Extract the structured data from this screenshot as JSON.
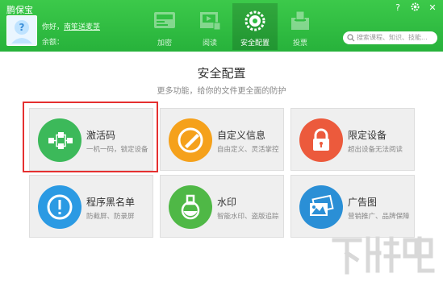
{
  "app": {
    "title": "鹏保宝"
  },
  "user": {
    "greeting_prefix": "你好，",
    "username": "南笙送麦茎",
    "balance_label": "余额："
  },
  "tabs": [
    {
      "label": "加密",
      "icon": "video-encrypt-icon"
    },
    {
      "label": "阅读",
      "icon": "film-reader-icon"
    },
    {
      "label": "安全配置",
      "icon": "gear-config-icon"
    },
    {
      "label": "投票",
      "icon": "vote-box-icon"
    }
  ],
  "window_buttons": {
    "help": "?",
    "settings": "gear-icon",
    "close": "✕"
  },
  "search": {
    "placeholder": "搜索课程、知识、技能..."
  },
  "main": {
    "title": "安全配置",
    "subtitle": "更多功能，给你的文件更全面的防护"
  },
  "cards": [
    {
      "title": "激活码",
      "subtitle": "一机一码，锁定设备",
      "icon": "flowchart-icon",
      "color": "#3cb95a"
    },
    {
      "title": "自定义信息",
      "subtitle": "自由定义、灵活掌控",
      "icon": "pencil-icon",
      "color": "#f5a11b"
    },
    {
      "title": "限定设备",
      "subtitle": "超出设备无法阅读",
      "icon": "lock-icon",
      "color": "#ec5a3c"
    },
    {
      "title": "程序黑名单",
      "subtitle": "防截屏、防录屏",
      "icon": "exclamation-icon",
      "color": "#2b9ae3"
    },
    {
      "title": "水印",
      "subtitle": "智能水印、盗版追踪",
      "icon": "flask-icon",
      "color": "#4fb846"
    },
    {
      "title": "广告图",
      "subtitle": "营销推广、品牌保障",
      "icon": "picture-icon",
      "color": "#2a8fd6"
    }
  ],
  "colors": {
    "header": "#2fbd43",
    "highlight": "#e53030",
    "card_bg": "#efefef"
  },
  "watermark": {
    "text": "下载吧"
  }
}
